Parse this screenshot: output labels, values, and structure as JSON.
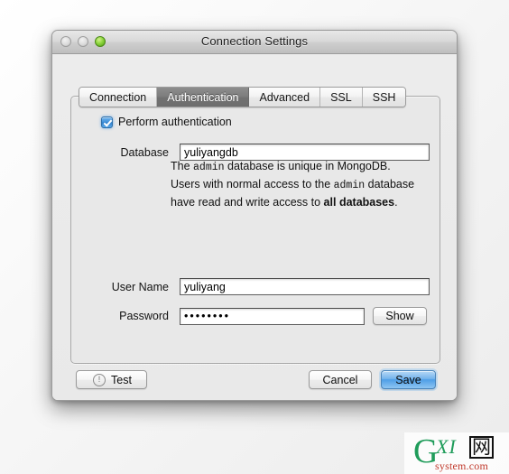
{
  "window": {
    "title": "Connection Settings",
    "traffic_lights": [
      {
        "name": "close-button",
        "state": "disabled",
        "color": "#dcdcdc"
      },
      {
        "name": "minimize-button",
        "state": "disabled",
        "color": "#dcdcdc"
      },
      {
        "name": "zoom-button",
        "state": "enabled",
        "color": "#8ed63f"
      }
    ]
  },
  "tabs": [
    {
      "id": "connection",
      "label": "Connection",
      "selected": false
    },
    {
      "id": "authentication",
      "label": "Authentication",
      "selected": true
    },
    {
      "id": "advanced",
      "label": "Advanced",
      "selected": false
    },
    {
      "id": "ssl",
      "label": "SSL",
      "selected": false
    },
    {
      "id": "ssh",
      "label": "SSH",
      "selected": false
    }
  ],
  "form": {
    "perform_auth": {
      "label": "Perform authentication",
      "checked": true
    },
    "database": {
      "label": "Database",
      "value": "yuliyangdb",
      "placeholder": ""
    },
    "description": {
      "line1_a": "The ",
      "line1_mono": "admin",
      "line1_b": " database is unique in MongoDB.",
      "line2_a": "Users with normal access to the ",
      "line2_mono": "admin",
      "line3_a": "database have read and write access to ",
      "line3_bold": "all",
      "line4_bold": "databases",
      "line4_b": "."
    },
    "user_name": {
      "label": "User Name",
      "value": "yuliyang",
      "placeholder": ""
    },
    "password": {
      "label": "Password",
      "value": "••••••••",
      "masked_char_count": 8,
      "placeholder": ""
    },
    "show_button": {
      "label": "Show"
    }
  },
  "footer": {
    "test": {
      "label": "Test",
      "icon": "warning-exclamation-icon",
      "icon_glyph": "!"
    },
    "cancel": {
      "label": "Cancel"
    },
    "save": {
      "label": "Save",
      "is_default": true,
      "accent_color": "#4e9ee6"
    }
  },
  "watermark": {
    "g": "G",
    "xi": "XI",
    "cjk": "网",
    "domain": "system.com",
    "green": "#1f9c5a",
    "red": "#c0392b"
  }
}
